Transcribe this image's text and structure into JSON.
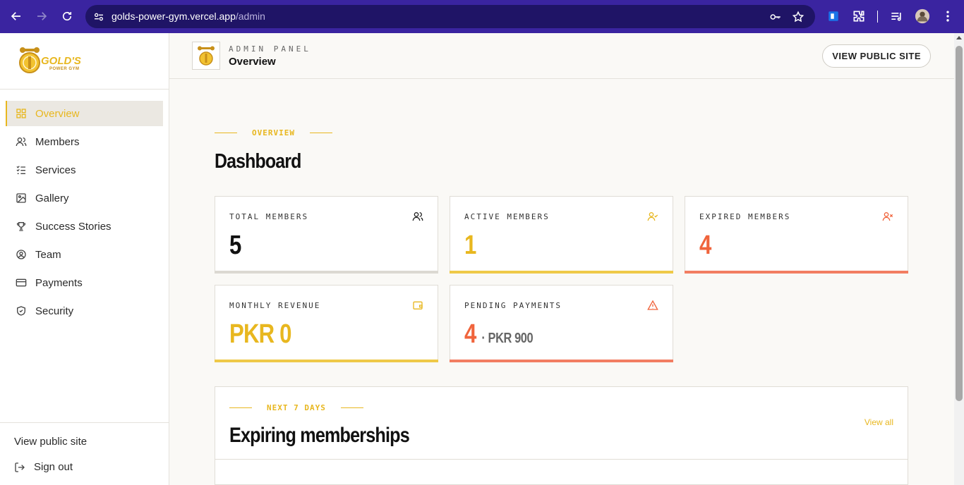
{
  "browser": {
    "url_host": "golds-power-gym.vercel.app",
    "url_path": "/admin"
  },
  "sidebar": {
    "logo_text": "GOLD'S",
    "logo_subtext": "POWER GYM",
    "items": [
      {
        "label": "Overview",
        "icon": "grid-icon"
      },
      {
        "label": "Members",
        "icon": "users-icon"
      },
      {
        "label": "Services",
        "icon": "checklist-icon"
      },
      {
        "label": "Gallery",
        "icon": "image-icon"
      },
      {
        "label": "Success Stories",
        "icon": "trophy-icon"
      },
      {
        "label": "Team",
        "icon": "user-circle-icon"
      },
      {
        "label": "Payments",
        "icon": "credit-card-icon"
      },
      {
        "label": "Security",
        "icon": "shield-icon"
      }
    ],
    "view_public_site": "View public site",
    "sign_out": "Sign out"
  },
  "header": {
    "eyebrow": "ADMIN PANEL",
    "title": "Overview",
    "public_button": "VIEW PUBLIC SITE"
  },
  "main": {
    "section_label": "OVERVIEW",
    "title": "Dashboard",
    "cards": [
      {
        "label": "TOTAL MEMBERS",
        "value": "5",
        "icon": "users-icon"
      },
      {
        "label": "ACTIVE MEMBERS",
        "value": "1",
        "icon": "user-check-icon"
      },
      {
        "label": "EXPIRED MEMBERS",
        "value": "4",
        "icon": "user-x-icon"
      },
      {
        "label": "MONTHLY REVENUE",
        "value": "PKR 0",
        "icon": "wallet-icon"
      },
      {
        "label": "PENDING PAYMENTS",
        "value": "4",
        "sub": "· PKR 900",
        "icon": "alert-triangle-icon"
      }
    ],
    "expiring": {
      "label": "NEXT 7 DAYS",
      "title": "Expiring memberships",
      "view_all": "View all"
    }
  },
  "colors": {
    "accent": "#e8b71f",
    "danger": "#f0643c",
    "chrome": "#3a24a0"
  }
}
